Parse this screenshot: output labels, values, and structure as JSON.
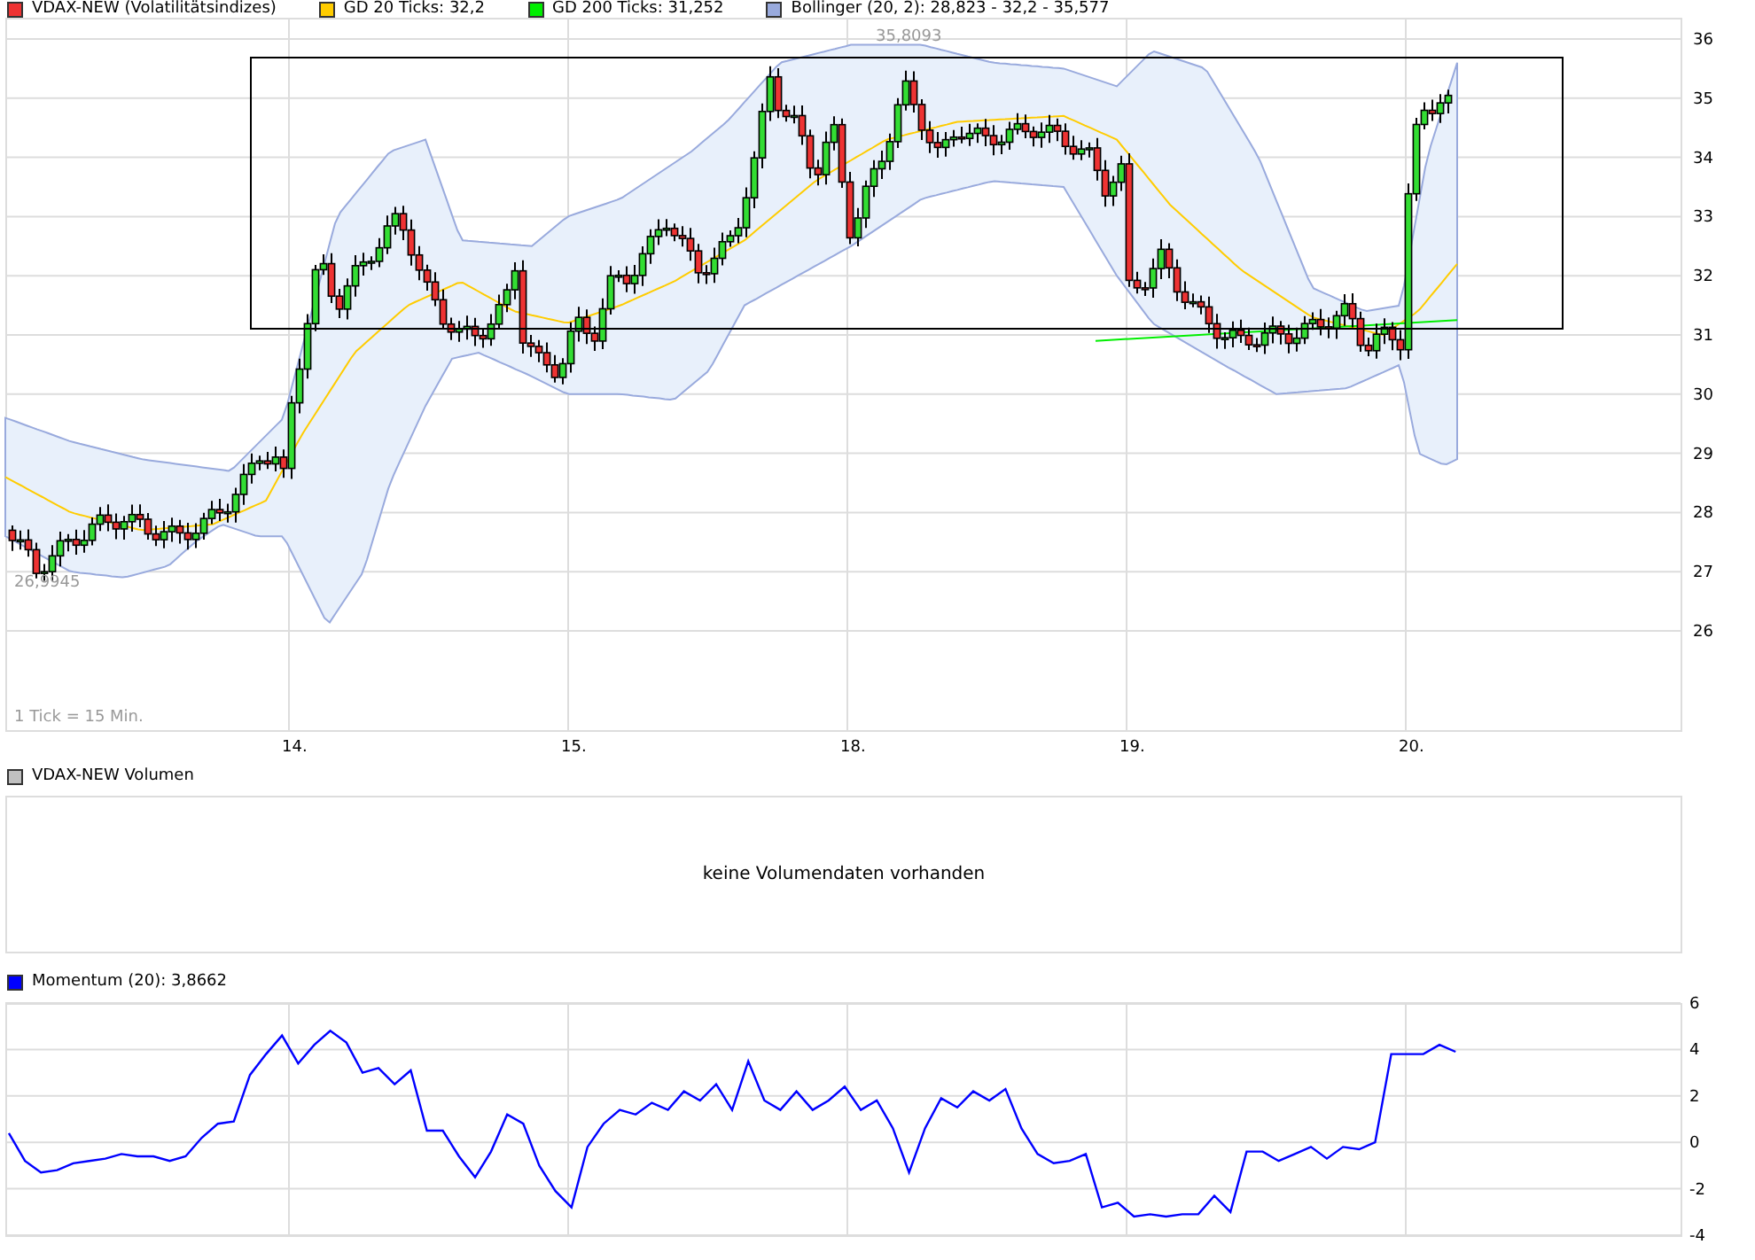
{
  "legend": [
    {
      "label": "VDAX-NEW (Volatilitätsindizes)",
      "color": "#ee3333"
    },
    {
      "label": "GD 20 Ticks: 32,2",
      "color": "#ffcc00"
    },
    {
      "label": "GD 200 Ticks: 31,252",
      "color": "#00ee00"
    },
    {
      "label": "Bollinger (20, 2): 28,823 - 32,2 - 35,577",
      "color": "#99aadd"
    }
  ],
  "price_panel": {
    "y_axis_labels": [
      "36",
      "35",
      "34",
      "33",
      "32",
      "31",
      "30",
      "29",
      "28",
      "27",
      "26"
    ],
    "x_axis_labels": [
      "14.",
      "15.",
      "18.",
      "19.",
      "20."
    ],
    "high_label": "35,8093",
    "low_label": "26,9945",
    "tick_note": "1 Tick = 15 Min."
  },
  "volume_panel": {
    "legend": {
      "label": "VDAX-NEW Volumen",
      "color": "#c0c0c0"
    },
    "message": "keine Volumendaten vorhanden"
  },
  "momentum_panel": {
    "legend": {
      "label_suffix": ": 3,8662",
      "color": "#0000ff"
    },
    "chart_data": {
      "type": "line",
      "categories": [
        null,
        null,
        null,
        null,
        null,
        null,
        null,
        null,
        null,
        null,
        null,
        null,
        null,
        null,
        null,
        null,
        null,
        null,
        null,
        null,
        null,
        null,
        null,
        null,
        null,
        null,
        null,
        null,
        null,
        null,
        null,
        null,
        null,
        null,
        null,
        null,
        null,
        null,
        null,
        null,
        null,
        null,
        null,
        null,
        null,
        null,
        null,
        null,
        null,
        null,
        null,
        null,
        null,
        null,
        null,
        null,
        null,
        null,
        null,
        null,
        null,
        null,
        null,
        null,
        null,
        null,
        null,
        null,
        null,
        null,
        null,
        null,
        null,
        null,
        null,
        null,
        null,
        null,
        null,
        null,
        null,
        null,
        null,
        null,
        null,
        null,
        null,
        null,
        null,
        null,
        null,
        null,
        null,
        null,
        null,
        null,
        null,
        null,
        null,
        null,
        null,
        null,
        null,
        null
      ],
      "grid": true,
      "ylim": [
        -4,
        6
      ],
      "yticks": [
        {
          "value": -4,
          "label": "-4"
        },
        {
          "value": -2,
          "label": "-2"
        },
        {
          "value": 0,
          "label": "0"
        },
        {
          "value": 2,
          "label": "2"
        },
        {
          "value": 4,
          "label": "4"
        },
        {
          "value": 6,
          "label": "6"
        }
      ],
      "series": [
        {
          "name": "Momentum (20)",
          "color": "#0000ff",
          "values": [
            0.4,
            -0.8,
            -1.3,
            -1.2,
            -0.9,
            -0.8,
            -0.7,
            -0.5,
            -0.6,
            -0.6,
            -0.8,
            -0.6,
            0.2,
            0.8,
            0.9,
            2.9,
            3.8,
            4.6,
            3.4,
            4.2,
            4.8,
            4.3,
            3.0,
            3.2,
            2.5,
            3.1,
            0.5,
            0.5,
            -0.6,
            -1.5,
            -0.4,
            1.2,
            0.8,
            -1.0,
            -2.1,
            -2.8,
            -0.2,
            0.8,
            1.4,
            1.2,
            1.7,
            1.4,
            2.2,
            1.8,
            2.5,
            1.4,
            3.5,
            1.8,
            1.4,
            2.2,
            1.4,
            1.8,
            2.4,
            1.4,
            1.8,
            0.6,
            -1.3,
            0.6,
            1.9,
            1.5,
            2.2,
            1.8,
            2.3,
            0.6,
            -0.5,
            -0.9,
            -0.8,
            -0.5,
            -2.8,
            -2.6,
            -3.2,
            -3.1,
            -3.2,
            -3.1,
            -3.1,
            -2.3,
            -3.0,
            -0.4,
            -0.4,
            -0.8,
            -0.5,
            -0.2,
            -0.7,
            -0.2,
            -0.3,
            0.0,
            3.8,
            3.8,
            3.8,
            4.2,
            3.9,
            null,
            null,
            null,
            null,
            null,
            null,
            null,
            null,
            null,
            null,
            null,
            null,
            null
          ]
        }
      ]
    }
  }
}
